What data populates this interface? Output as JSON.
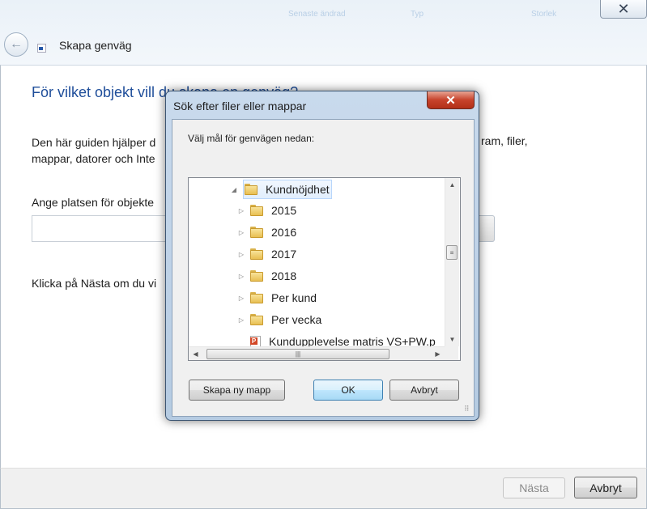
{
  "wizard": {
    "title": "Skapa genväg",
    "blurred_top": [
      "Senaste ändrad",
      "Typ",
      "Storlek"
    ],
    "heading": "För vilket objekt vill du skapa en genväg?",
    "description_line1_left": "Den här guiden hjälper d",
    "description_line1_right": "ram, filer,",
    "description_line2": "mappar, datorer och Inte",
    "location_label": "Ange platsen för objekte",
    "location_value": "",
    "instruction": "Klicka på Nästa om du vi",
    "next_label": "Nästa",
    "cancel_label": "Avbryt",
    "next_enabled": false
  },
  "dialog": {
    "title": "Sök efter filer eller mappar",
    "prompt": "Välj mål för genvägen nedan:",
    "tree": [
      {
        "label": "Kundnöjdhet",
        "expanded": true,
        "selected": true,
        "type": "folder"
      },
      {
        "label": "2015",
        "expanded": false,
        "type": "folder"
      },
      {
        "label": "2016",
        "expanded": false,
        "type": "folder"
      },
      {
        "label": "2017",
        "expanded": false,
        "type": "folder"
      },
      {
        "label": "2018",
        "expanded": false,
        "type": "folder"
      },
      {
        "label": "Per kund",
        "expanded": false,
        "type": "folder"
      },
      {
        "label": "Per vecka",
        "expanded": false,
        "type": "folder"
      },
      {
        "label": "Kundupplevelse matris VS+PW.p",
        "type": "pptx-file"
      }
    ],
    "new_folder_label": "Skapa ny mapp",
    "ok_label": "OK",
    "cancel_label": "Avbryt",
    "close_glyph": "✕"
  },
  "icons": {
    "close": "close-icon",
    "back": "back-arrow-icon",
    "folder": "folder-icon",
    "expand": "expand-arrow-icon",
    "collapse": "collapse-arrow-icon",
    "file": "powerpoint-file-icon"
  }
}
